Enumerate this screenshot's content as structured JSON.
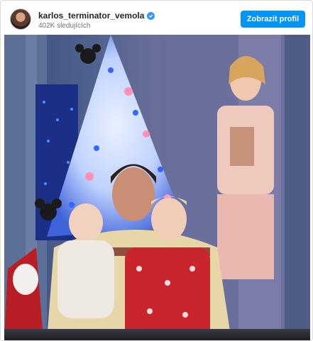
{
  "post": {
    "username": "karlos_terminator_vemola",
    "followers": "402K sledujících",
    "view_profile_label": "Zobrazit profil"
  },
  "colors": {
    "button": "#0095f6",
    "verified_badge": "#3897f0",
    "username": "#262626",
    "secondary_text": "#737373"
  },
  "icons": {
    "verified": "verified-badge-icon",
    "avatar": "profile-avatar"
  },
  "photo": {
    "type": "family-photo-christmas-tree"
  }
}
